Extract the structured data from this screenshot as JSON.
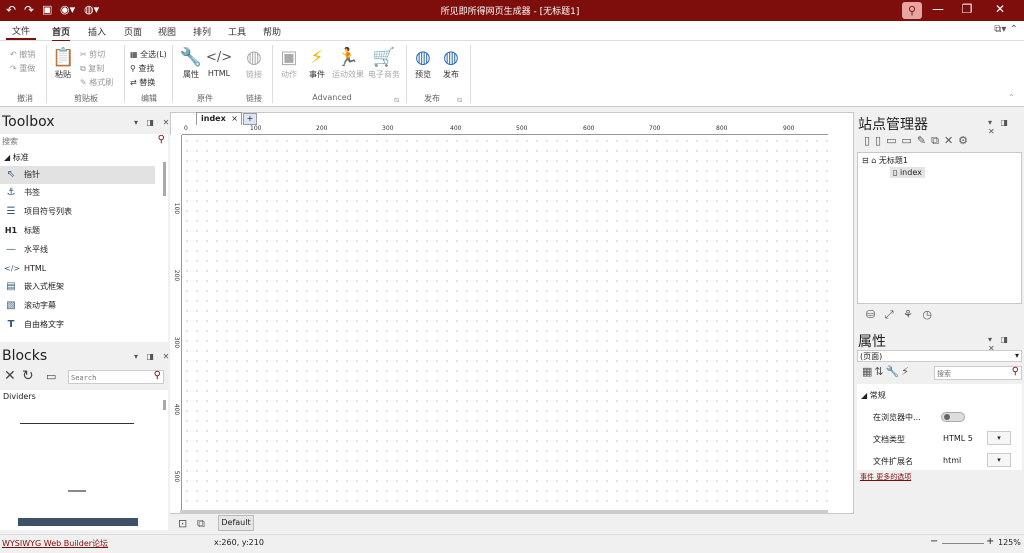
{
  "titlebar": {
    "title": "所见即所得网页生成器 - [无标题1]",
    "minimize_icon": "minimize-icon",
    "restore_icon": "restore-icon",
    "close_icon": "close-icon"
  },
  "menu": {
    "file": "文件",
    "tabs": [
      "首页",
      "插入",
      "页面",
      "视图",
      "排列",
      "工具",
      "帮助"
    ],
    "active_tab": "首页"
  },
  "ribbon": {
    "undo": "撤销",
    "redo": "重做",
    "paste": "粘贴",
    "cut": "剪切",
    "copy": "复制",
    "format_painter": "格式刷",
    "select_all": "全选(L)",
    "find": "查找",
    "replace": "替换",
    "properties": "属性",
    "html": "HTML",
    "link": "链接",
    "action": "动作",
    "events": "事件",
    "animation": "运动效果",
    "ecommerce": "电子商务",
    "preview": "预览",
    "publish": "发布",
    "groups": {
      "undo_group": "撤消",
      "clipboard": "剪贴板",
      "edit": "编辑",
      "element": "原件",
      "link": "链接",
      "advanced": "Advanced",
      "publish": "发布"
    }
  },
  "toolbox": {
    "title": "Toolbox",
    "search_placeholder": "搜索",
    "category": "标准",
    "items": [
      {
        "label": "指针",
        "icon": "pointer-icon"
      },
      {
        "label": "书签",
        "icon": "anchor-icon"
      },
      {
        "label": "项目符号列表",
        "icon": "bullet-list-icon"
      },
      {
        "label": "标题",
        "icon": "heading-icon"
      },
      {
        "label": "水平线",
        "icon": "horizontal-line-icon"
      },
      {
        "label": "HTML",
        "icon": "html-icon"
      },
      {
        "label": "嵌入式框架",
        "icon": "iframe-icon"
      },
      {
        "label": "滚动字幕",
        "icon": "marquee-icon"
      },
      {
        "label": "自由格文字",
        "icon": "text-icon"
      }
    ],
    "heading_glyph": "H1"
  },
  "blocks": {
    "title": "Blocks",
    "search_placeholder": "Search",
    "category": "Dividers"
  },
  "document": {
    "tab": "index",
    "ruler_h": [
      "0",
      "100",
      "200",
      "300",
      "400",
      "500",
      "600",
      "700",
      "800",
      "900"
    ],
    "ruler_v": [
      "100",
      "200",
      "300",
      "400",
      "500"
    ],
    "page_label": "Default"
  },
  "site_manager": {
    "title": "站点管理器",
    "root": "无标题1",
    "page": "index"
  },
  "properties": {
    "title": "属性",
    "selector": "(页面)",
    "search_placeholder": "搜索",
    "section": "常规",
    "rows": [
      {
        "label": "在浏览器中...",
        "value": ""
      },
      {
        "label": "文档类型",
        "value": "HTML 5"
      },
      {
        "label": "文件扩展名",
        "value": "html"
      }
    ],
    "footer_links": "事件 更多的选项"
  },
  "statusbar": {
    "left_link": "WYSIWYG Web Builder论坛",
    "coords": "x:260, y:210",
    "zoom": "125%"
  },
  "colors": {
    "title_bg": "#7e0e0c",
    "accent": "#7e0e0c"
  }
}
